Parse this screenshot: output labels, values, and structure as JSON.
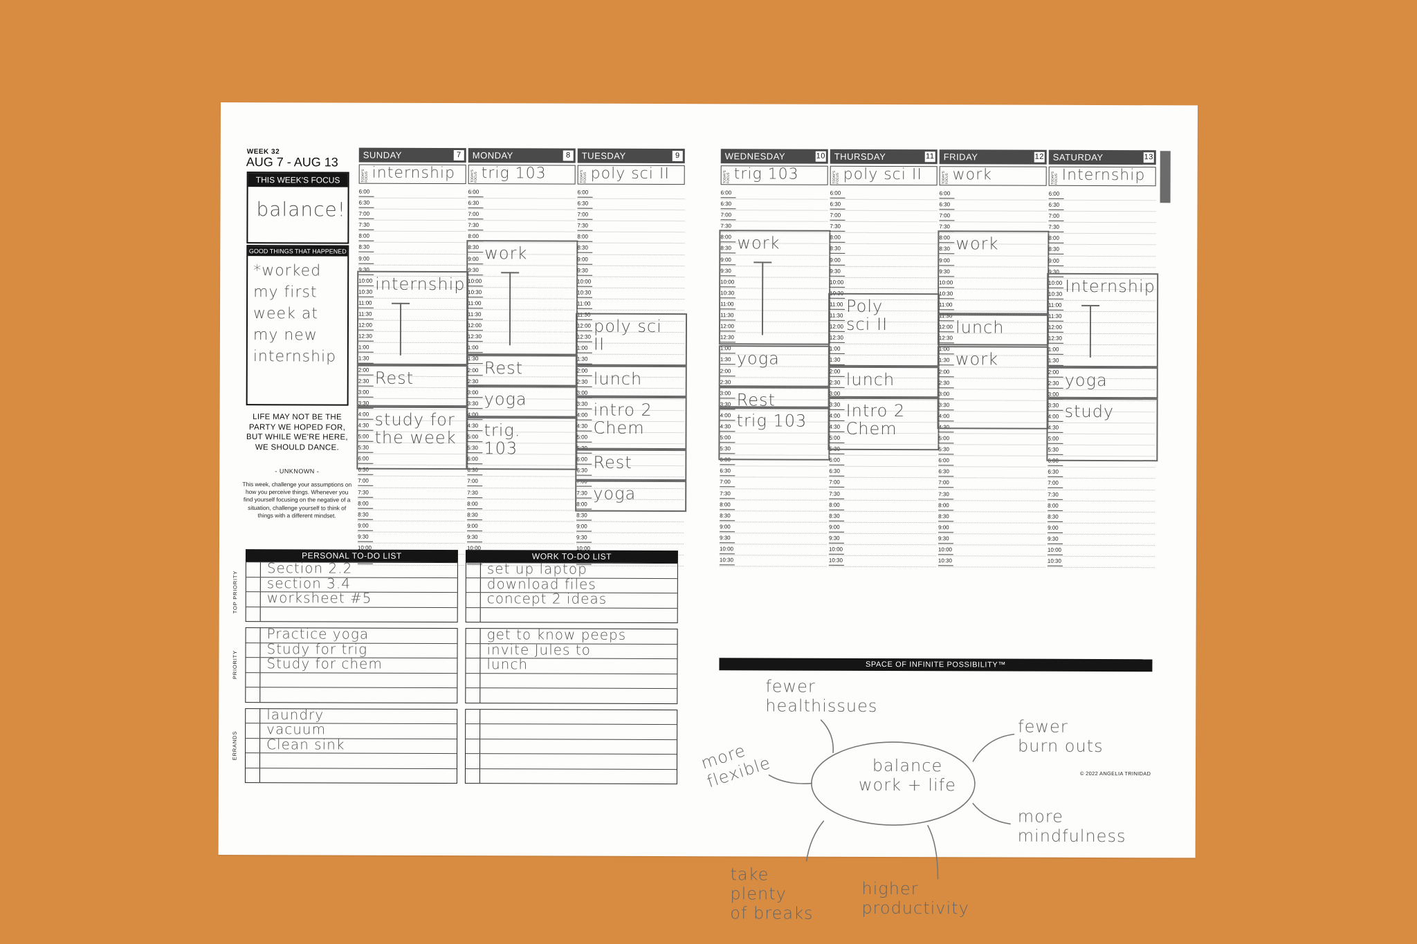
{
  "planner": {
    "week_label": "WEEK 32",
    "week_range": "AUG 7 - AUG 13",
    "focus_title": "THIS WEEK'S FOCUS",
    "focus_value": "balance!",
    "good_things_title": "GOOD THINGS THAT HAPPENED",
    "good_things_value": "*worked\nmy first\nweek at\nmy new\ninternship",
    "quote": "LIFE MAY NOT BE THE PARTY WE HOPED FOR, BUT WHILE WE'RE HERE, WE SHOULD DANCE.",
    "quote_author": "- UNKNOWN -",
    "challenge": "This week, challenge your assumptions on how you perceive things. Whenever you find yourself focusing on the negative of a situation, challenge yourself to think of things with a different mindset.",
    "todays_focus_tag": "TODAY'S FOCUS",
    "time_slots": [
      "6:00",
      "6:30",
      "7:00",
      "7:30",
      "8:00",
      "8:30",
      "9:00",
      "9:30",
      "10:00",
      "10:30",
      "11:00",
      "11:30",
      "12:00",
      "12:30",
      "1:00",
      "1:30",
      "2:00",
      "2:30",
      "3:00",
      "3:30",
      "4:00",
      "4:30",
      "5:00",
      "5:30",
      "6:00",
      "6:30",
      "7:00",
      "7:30",
      "8:00",
      "8:30",
      "9:00",
      "9:30",
      "10:00",
      "10:30"
    ],
    "days": [
      {
        "name": "SUNDAY",
        "date": "7",
        "focus": "internship",
        "blocks": [
          {
            "label": "internship",
            "start": "10:00",
            "end": "2:30",
            "arrow": true
          },
          {
            "label": "Rest",
            "start": "2:30",
            "end": "4:30"
          },
          {
            "label": "study for\nthe week",
            "start": "4:30",
            "end": "7:30"
          }
        ]
      },
      {
        "name": "MONDAY",
        "date": "8",
        "focus": "trig 103",
        "blocks": [
          {
            "label": "work",
            "start": "8:30",
            "end": "2:00",
            "arrow": true
          },
          {
            "label": "Rest",
            "start": "2:00",
            "end": "3:30"
          },
          {
            "label": "yoga",
            "start": "3:30",
            "end": "5:00"
          },
          {
            "label": "trig.\n103",
            "start": "5:00",
            "end": "7:30"
          }
        ]
      },
      {
        "name": "TUESDAY",
        "date": "9",
        "focus": "poly sci II",
        "blocks": [
          {
            "label": "poly sci\nII",
            "start": "12:00",
            "end": "2:30"
          },
          {
            "label": "lunch",
            "start": "2:30",
            "end": "4:00"
          },
          {
            "label": "intro 2\nChem",
            "start": "4:00",
            "end": "6:30"
          },
          {
            "label": "Rest",
            "start": "6:30",
            "end": "8:00"
          },
          {
            "label": "yoga",
            "start": "8:00",
            "end": "9:30"
          }
        ]
      },
      {
        "name": "WEDNESDAY",
        "date": "10",
        "focus": "trig 103",
        "blocks": [
          {
            "label": "work",
            "start": "8:00",
            "end": "1:30",
            "arrow": true
          },
          {
            "label": "yoga",
            "start": "1:30",
            "end": "3:30"
          },
          {
            "label": "Rest",
            "start": "3:30",
            "end": "4:30"
          },
          {
            "label": "trig 103",
            "start": "4:30",
            "end": "7:00"
          }
        ]
      },
      {
        "name": "THURSDAY",
        "date": "11",
        "focus": "poly sci II",
        "blocks": [
          {
            "label": "Poly\nsci II",
            "start": "11:00",
            "end": "2:30"
          },
          {
            "label": "lunch",
            "start": "2:30",
            "end": "4:00"
          },
          {
            "label": "Intro 2\nChem",
            "start": "4:00",
            "end": "6:30"
          }
        ]
      },
      {
        "name": "FRIDAY",
        "date": "12",
        "focus": "work",
        "blocks": [
          {
            "label": "work",
            "start": "8:00",
            "end": "12:00"
          },
          {
            "label": "lunch",
            "start": "12:00",
            "end": "1:30"
          },
          {
            "label": "work",
            "start": "1:30",
            "end": "5:30"
          }
        ]
      },
      {
        "name": "SATURDAY",
        "date": "13",
        "focus": "Internship",
        "blocks": [
          {
            "label": "Internship",
            "start": "10:00",
            "end": "2:30",
            "arrow": true
          },
          {
            "label": "yoga",
            "start": "2:30",
            "end": "4:00"
          },
          {
            "label": "study",
            "start": "4:00",
            "end": "7:00"
          }
        ]
      }
    ],
    "personal_todo": {
      "title": "PERSONAL TO-DO LIST",
      "groups": [
        {
          "category": "TOP PRIORITY",
          "items": [
            "Section 2.2",
            "section 3.4",
            "worksheet #5",
            ""
          ]
        },
        {
          "category": "PRIORITY",
          "items": [
            "Practice yoga",
            "Study for trig",
            "Study for chem",
            "",
            ""
          ]
        },
        {
          "category": "ERRANDS",
          "items": [
            "laundry",
            "vacuum",
            "Clean sink",
            "",
            ""
          ]
        }
      ]
    },
    "work_todo": {
      "title": "WORK TO-DO LIST",
      "groups": [
        {
          "items": [
            "set up laptop",
            "download files",
            "concept 2 ideas",
            ""
          ]
        },
        {
          "items": [
            "get to know peeps",
            "invite Jules to",
            "lunch",
            "",
            ""
          ]
        },
        {
          "items": [
            "",
            "",
            "",
            "",
            ""
          ]
        }
      ]
    },
    "space_title": "SPACE OF INFINITE POSSIBILITY™",
    "mind_map": {
      "center": "balance\nwork + life",
      "branches": [
        "fewer\nhealthissues",
        "more\nflexible",
        "fewer\nburn outs",
        "more\nmindfulness",
        "take\nplenty\nof breaks",
        "higher\nproductivity"
      ]
    },
    "copyright": "© 2022 ANGELIA TRINIDAD"
  }
}
